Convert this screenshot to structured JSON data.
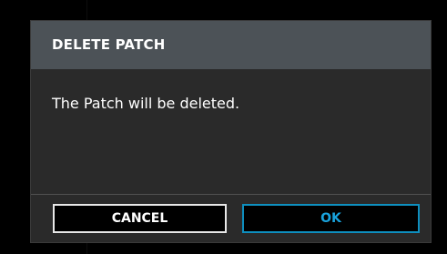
{
  "dialog": {
    "title": "DELETE PATCH",
    "message": "The Patch will be deleted.",
    "cancel_label": "CANCEL",
    "ok_label": "OK"
  },
  "colors": {
    "header_bg": "#4c5257",
    "body_bg": "#2a2a2a",
    "ok_accent": "#19a3dd",
    "cancel_border": "#e8e8e8"
  }
}
